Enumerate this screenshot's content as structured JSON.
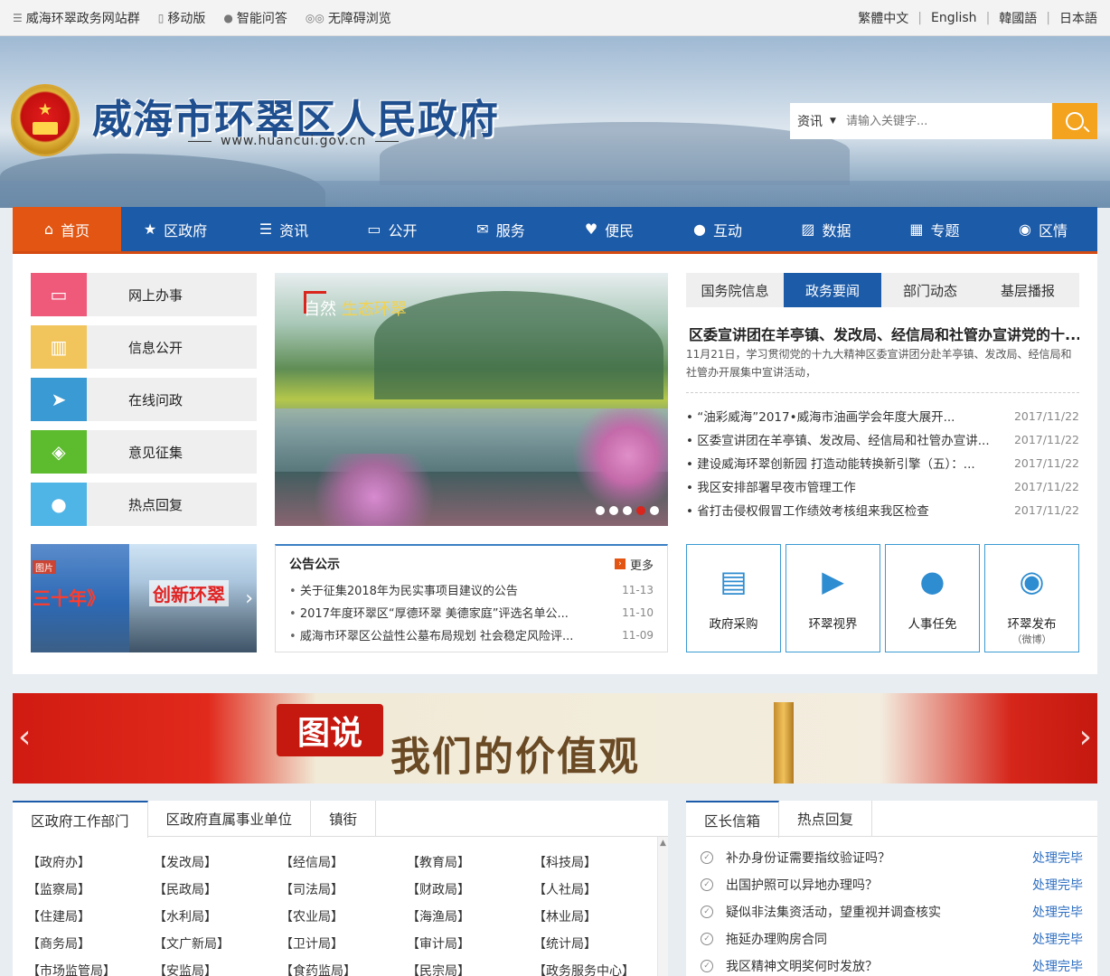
{
  "topbar": {
    "left": [
      {
        "icon": "menu-icon",
        "label": "威海环翠政务网站群"
      },
      {
        "icon": "mobile-icon",
        "label": "移动版"
      },
      {
        "icon": "chat-icon",
        "label": "智能问答"
      },
      {
        "icon": "glasses-icon",
        "label": "无障碍浏览"
      }
    ],
    "languages": [
      "繁體中文",
      "English",
      "韓國語",
      "日本語"
    ]
  },
  "header": {
    "title": "威海市环翠区人民政府",
    "url": "www.huancui.gov.cn",
    "search": {
      "category": "资讯",
      "placeholder": "请输入关键字..."
    }
  },
  "nav": [
    {
      "label": "首页",
      "icon": "home-icon",
      "active": true
    },
    {
      "label": "区政府",
      "icon": "star-icon"
    },
    {
      "label": "资讯",
      "icon": "list-icon"
    },
    {
      "label": "公开",
      "icon": "book-icon"
    },
    {
      "label": "服务",
      "icon": "mail-icon"
    },
    {
      "label": "便民",
      "icon": "heart-icon"
    },
    {
      "label": "互动",
      "icon": "chat-icon"
    },
    {
      "label": "数据",
      "icon": "chart-icon"
    },
    {
      "label": "专题",
      "icon": "grid-icon"
    },
    {
      "label": "区情",
      "icon": "location-icon"
    }
  ],
  "services": [
    {
      "label": "网上办事",
      "icon": "monitor-icon",
      "color": "#ef5a7a"
    },
    {
      "label": "信息公开",
      "icon": "book-open-icon",
      "color": "#f2c55c"
    },
    {
      "label": "在线问政",
      "icon": "send-icon",
      "color": "#3a9ad3"
    },
    {
      "label": "意见征集",
      "icon": "layers-icon",
      "color": "#5dbb2e"
    },
    {
      "label": "热点回复",
      "icon": "chat-bubbles-icon",
      "color": "#4fb4e6"
    }
  ],
  "promo": {
    "left_text": "三十年》",
    "left_tag": "图片",
    "right_text": "创新环翠"
  },
  "carousel": {
    "caption_a": "自然",
    "caption_b": "生态环翠"
  },
  "notice": {
    "title": "公告公示",
    "more": "更多",
    "items": [
      {
        "text": "关于征集2018年为民实事项目建议的公告",
        "date": "11-13"
      },
      {
        "text": "2017年度环翠区“厚德环翠 美德家庭”评选名单公...",
        "date": "11-10"
      },
      {
        "text": "威海市环翠区公益性公墓布局规划 社会稳定风险评...",
        "date": "11-09"
      }
    ]
  },
  "news": {
    "tabs": [
      "国务院信息",
      "政务要闻",
      "部门动态",
      "基层播报"
    ],
    "active_tab": 1,
    "headline": "区委宣讲团在羊亭镇、发改局、经信局和社管办宣讲党的十...",
    "summary": "11月21日，学习贯彻党的十九大精神区委宣讲团分赴羊亭镇、发改局、经信局和社管办开展集中宣讲活动，",
    "items": [
      {
        "text": "“油彩威海”2017•威海市油画学会年度大展开...",
        "date": "2017/11/22"
      },
      {
        "text": "区委宣讲团在羊亭镇、发改局、经信局和社管办宣讲...",
        "date": "2017/11/22"
      },
      {
        "text": "建设威海环翠创新园 打造动能转换新引擎（五）：...",
        "date": "2017/11/22"
      },
      {
        "text": "我区安排部署早夜市管理工作",
        "date": "2017/11/22"
      },
      {
        "text": "省打击侵权假冒工作绩效考核组来我区检查",
        "date": "2017/11/22"
      }
    ]
  },
  "quick_links": [
    {
      "label": "政府采购",
      "icon": "document-add-icon",
      "sub": ""
    },
    {
      "label": "环翠视界",
      "icon": "video-camera-icon",
      "sub": ""
    },
    {
      "label": "人事任免",
      "icon": "person-icon",
      "sub": ""
    },
    {
      "label": "环翠发布",
      "icon": "weibo-icon",
      "sub": "（微博）"
    }
  ],
  "banner": {
    "badge": "图说",
    "message": "我们的价值观"
  },
  "departments": {
    "tabs": [
      "区政府工作部门",
      "区政府直属事业单位",
      "镇街"
    ],
    "items": [
      "【政府办】",
      "【发改局】",
      "【经信局】",
      "【教育局】",
      "【科技局】",
      "【监察局】",
      "【民政局】",
      "【司法局】",
      "【财政局】",
      "【人社局】",
      "【住建局】",
      "【水利局】",
      "【农业局】",
      "【海渔局】",
      "【林业局】",
      "【商务局】",
      "【文广新局】",
      "【卫计局】",
      "【审计局】",
      "【统计局】",
      "【市场监管局】",
      "【安监局】",
      "【食药监局】",
      "【民宗局】",
      "【政务服务中心】"
    ]
  },
  "mailbox": {
    "tabs": [
      "区长信箱",
      "热点回复"
    ],
    "items": [
      {
        "text": "补办身份证需要指纹验证吗？",
        "status": "处理完毕"
      },
      {
        "text": "出国护照可以异地办理吗？",
        "status": "处理完毕"
      },
      {
        "text": "疑似非法集资活动，望重视并调查核实",
        "status": "处理完毕"
      },
      {
        "text": "拖延办理购房合同",
        "status": "处理完毕"
      },
      {
        "text": "我区精神文明奖何时发放？",
        "status": "处理完毕"
      }
    ]
  }
}
